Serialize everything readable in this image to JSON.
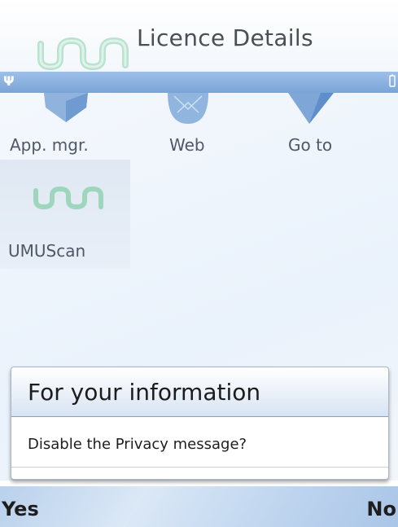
{
  "window": {
    "title": "Licence Details"
  },
  "apps": [
    {
      "label": "App. mgr.",
      "icon": "app-manager-icon"
    },
    {
      "label": "Web",
      "icon": "globe-icon"
    },
    {
      "label": "Go to",
      "icon": "goto-icon"
    },
    {
      "label": "UMUScan",
      "icon": "umu-logo-icon"
    }
  ],
  "dialog": {
    "title": "For your information",
    "message": "Disable the Privacy message?"
  },
  "softkeys": {
    "left": "Yes",
    "right": "No"
  },
  "colors": {
    "accent": "#7aa4d6",
    "logo": "#8fcfb4"
  }
}
